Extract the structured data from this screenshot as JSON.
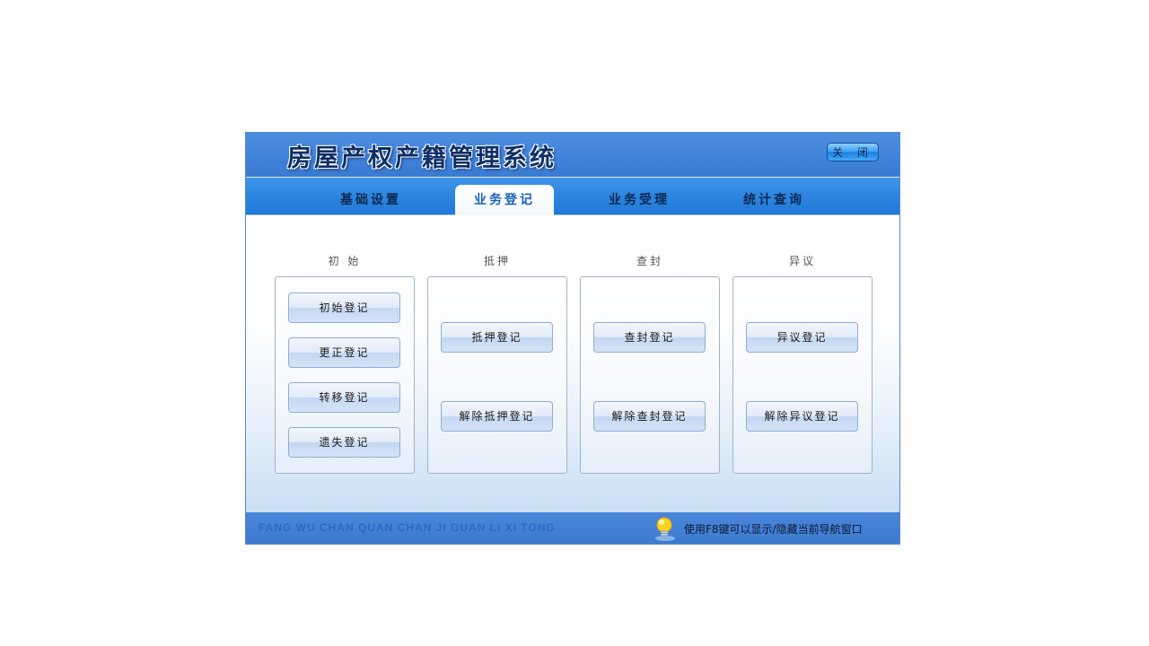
{
  "app": {
    "title": "房屋产权产籍管理系统",
    "close_label": "关 闭"
  },
  "tabs": [
    {
      "label": "基础设置",
      "active": false
    },
    {
      "label": "业务登记",
      "active": true
    },
    {
      "label": "业务受理",
      "active": false
    },
    {
      "label": "统计查询",
      "active": false
    }
  ],
  "groups": [
    {
      "title": "初  始",
      "buttons": [
        "初始登记",
        "更正登记",
        "转移登记",
        "遗失登记"
      ]
    },
    {
      "title": "抵押",
      "buttons": [
        "抵押登记",
        "解除抵押登记"
      ]
    },
    {
      "title": "查封",
      "buttons": [
        "查封登记",
        "解除查封登记"
      ]
    },
    {
      "title": "异议",
      "buttons": [
        "异议登记",
        "解除异议登记"
      ]
    }
  ],
  "footer": {
    "pinyin": "FANG WU CHAN QUAN CHAN JI GUAN LI XI TONG",
    "hint": "使用F8键可以显示/隐藏当前导航窗口",
    "hint_icon": "lightbulb-icon"
  },
  "colors": {
    "header_blue": "#3f82d9",
    "tab_text": "#0c2a55",
    "active_tab_text": "#1a5fb8"
  }
}
